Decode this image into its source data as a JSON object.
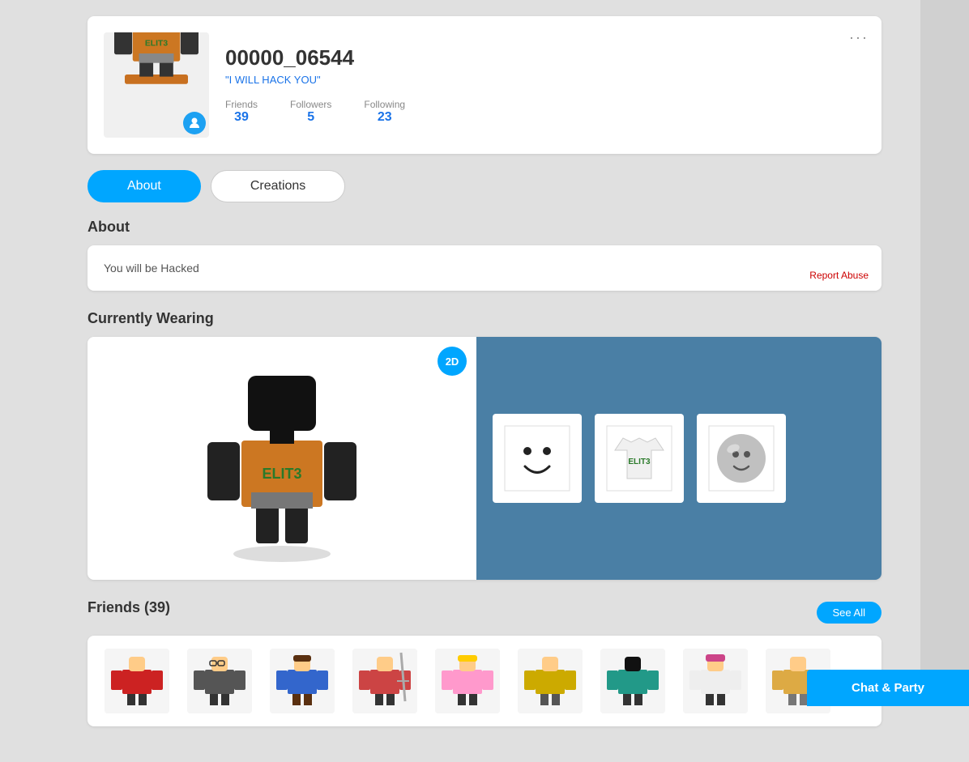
{
  "profile": {
    "username": "00000_06544",
    "status": "\"I WILL HACK YOU\"",
    "friends_label": "Friends",
    "friends_count": "39",
    "followers_label": "Followers",
    "followers_count": "5",
    "following_label": "Following",
    "following_count": "23",
    "menu_icon": "···"
  },
  "tabs": {
    "about_label": "About",
    "creations_label": "Creations"
  },
  "about_section": {
    "title": "About",
    "text": "You will be Hacked",
    "report_label": "Report Abuse"
  },
  "wearing_section": {
    "title": "Currently Wearing",
    "badge_label": "2D"
  },
  "friends_section": {
    "title": "Friends (39)",
    "see_all_label": "See All"
  },
  "chat_bar": {
    "label": "Chat & Party"
  }
}
